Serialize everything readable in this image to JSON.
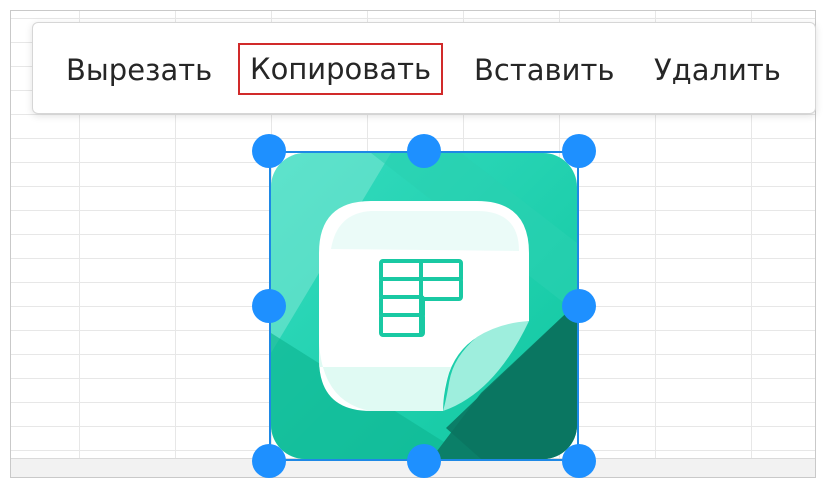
{
  "context_menu": {
    "items": [
      {
        "label": "Вырезать"
      },
      {
        "label": "Копировать"
      },
      {
        "label": "Вставить"
      },
      {
        "label": "Удалить"
      }
    ],
    "highlighted_item": "Копировать"
  },
  "selected_object": {
    "type": "image",
    "icon": "spreadsheet-app-icon"
  },
  "colors": {
    "highlight_border": "#d12a2a",
    "selection_blue": "#1e88e5",
    "handle_blue": "#1e90ff",
    "icon_teal_light": "#14d6b0",
    "icon_teal_dark": "#0f8f75"
  }
}
